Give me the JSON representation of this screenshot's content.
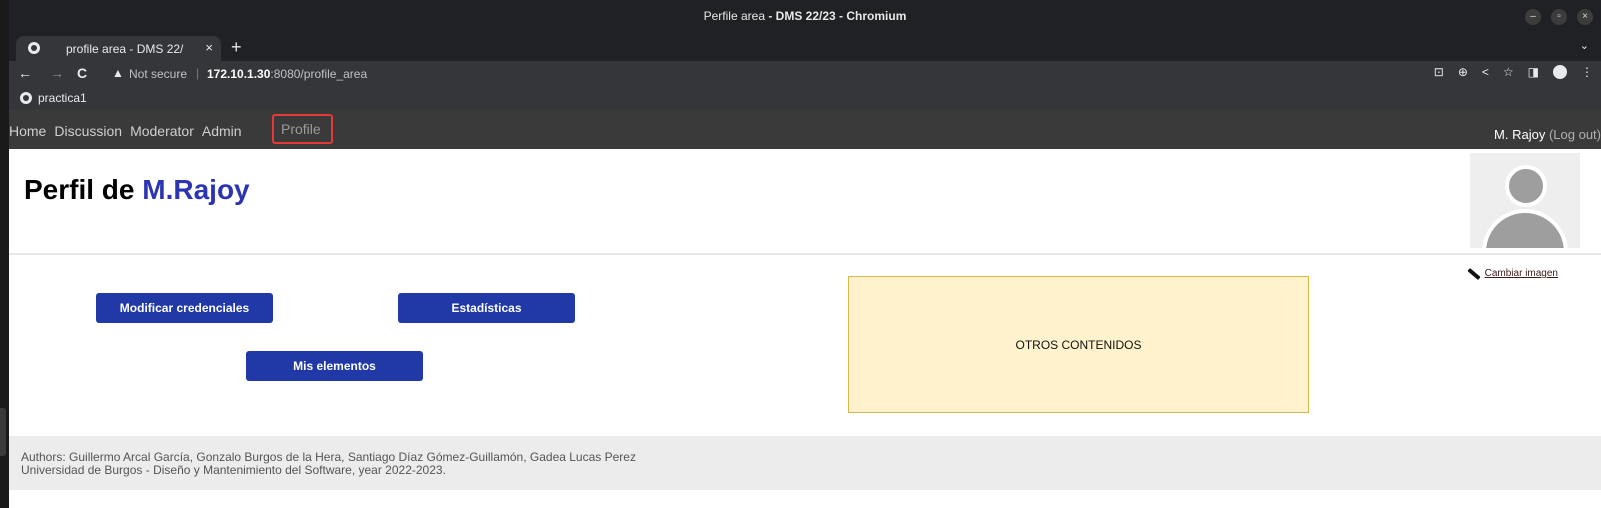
{
  "window": {
    "title_plain": "Perfile area",
    "title_bold": "- DMS 22/23 - Chromium",
    "controls": [
      "–",
      "▫",
      "×"
    ]
  },
  "tab": {
    "title": "profile area - DMS 22/",
    "close": "×",
    "new_tab": "+",
    "menu": "⌄"
  },
  "toolbar": {
    "back": "←",
    "forward": "→",
    "reload": "C",
    "security_icon": "▲",
    "security_text": "Not secure",
    "url_host": "172.10.1.30",
    "url_rest": ":8080/profile_area",
    "tools": [
      "⊡",
      "⊕",
      "<",
      "☆",
      "◨",
      "⋮"
    ]
  },
  "bookmarks": {
    "items": [
      {
        "label": "practica1"
      }
    ]
  },
  "appnav": {
    "links": [
      "Home",
      "Discussion",
      "Moderator",
      "Admin"
    ],
    "profile": "Profile",
    "user": "M. Rajoy",
    "logout": "(Log out)"
  },
  "profile": {
    "title_prefix": "Perfil de",
    "name": "M.Rajoy",
    "change_image": "Cambiar imagen"
  },
  "buttons": {
    "credentials": "Modificar credenciales",
    "stats": "Estadísticas",
    "my_items": "Mis elementos"
  },
  "other_content": "OTROS CONTENIDOS",
  "footer": {
    "line1": "Authors: Guillermo Arcal García, Gonzalo Burgos de la Hera, Santiago Díaz Gómez-Guillamón, Gadea Lucas Perez",
    "line2": "Universidad de Burgos - Diseño y Mantenimiento del Software, year 2022-2023."
  }
}
